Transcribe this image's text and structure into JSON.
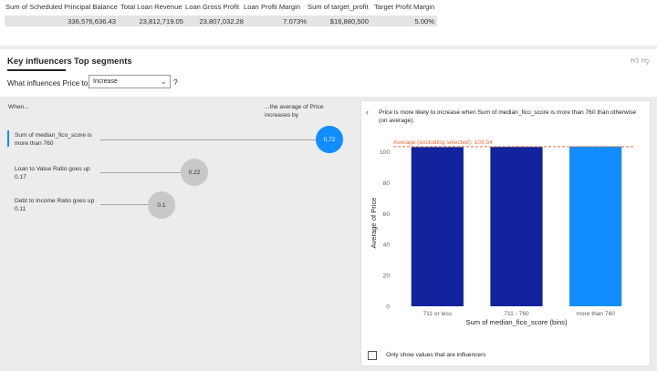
{
  "table": {
    "headers": [
      "Sum of Scheduled Principal Balance",
      "Total Loan Revenue",
      "Loan Gross Profit",
      "Loan Profit Margin",
      "Sum of target_profit",
      "Target Profit Margin"
    ],
    "values": [
      "336,576,636.43",
      "23,812,719.05",
      "23,807,032.28",
      "7.073%",
      "$16,880,500",
      "5.00%"
    ]
  },
  "tabs": {
    "key_influencers": "Key influencers",
    "top_segments": "Top segments"
  },
  "question": {
    "label": "What influences Price to",
    "selected": "Increase",
    "help": "?"
  },
  "influencers": {
    "when_header": "When...",
    "avg_header": "...the average of Price increases by",
    "items": [
      {
        "label": "Sum of median_fico_score is more than 760",
        "value": "0.72"
      },
      {
        "label": "Loan to Value Ratio goes up 0.17",
        "value": "0.22"
      },
      {
        "label": "Debt to Income Ratio goes up 0.11",
        "value": "0.1"
      }
    ]
  },
  "detail": {
    "text": "Price is more likely to increase when Sum of median_fico_score is more than 760 than otherwise (on average).",
    "checkbox_label": "Only show values that are influencers"
  },
  "chart_data": {
    "type": "bar",
    "categories": [
      "711 or less",
      "711 - 760",
      "more than 760"
    ],
    "values": [
      103.1,
      103.2,
      103.5
    ],
    "colors": [
      "#12239e",
      "#12239e",
      "#118dff"
    ],
    "reference_line": {
      "label": "Average (excluding selected): 103.34",
      "value": 103.34,
      "color": "#e66c37"
    },
    "xlabel": "Sum of median_fico_score (bins)",
    "ylabel": "Average of Price",
    "ylim": [
      0,
      108
    ],
    "yticks": [
      0,
      20,
      40,
      60,
      80,
      100
    ]
  }
}
